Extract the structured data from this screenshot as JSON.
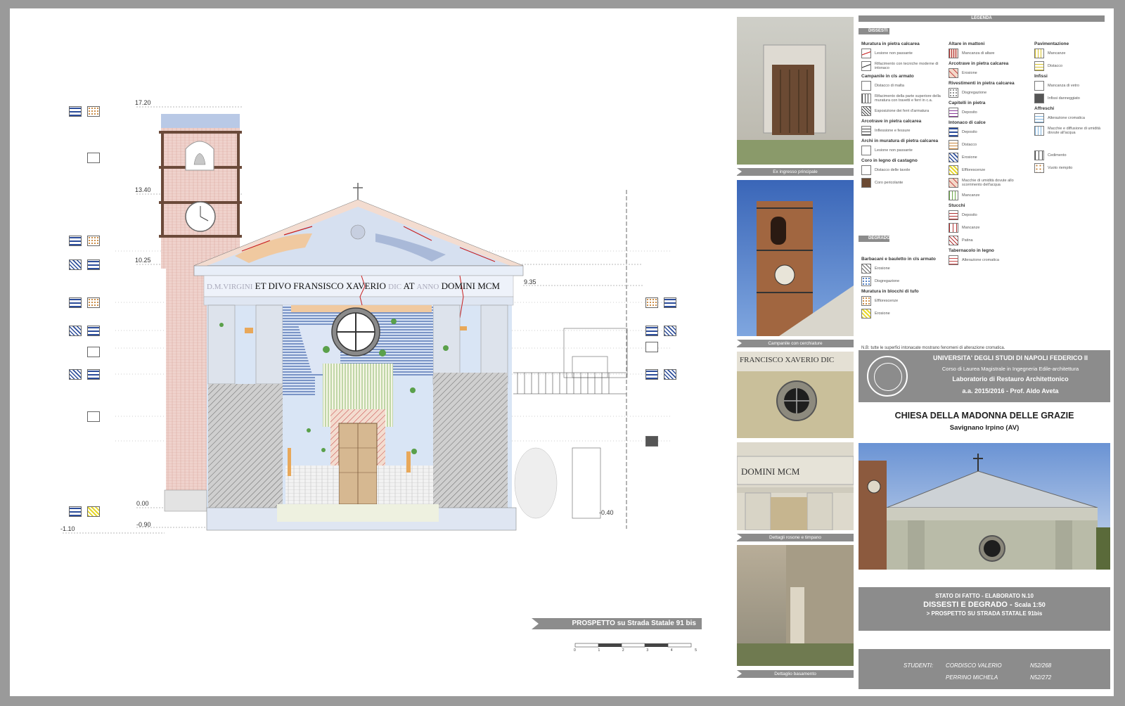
{
  "levels": {
    "l1720": "17.20",
    "l1340": "13.40",
    "l1025": "10.25",
    "l935": "9.35",
    "l000": "0.00",
    "lm090": "-0.90",
    "lm110": "-1.10",
    "lm040": "-0.40"
  },
  "inscription": {
    "part1": "D.M.VIRGINI",
    "part2": "ET DIVO FRANSISCO XAVERIO",
    "part3": "DIC",
    "part4": "AT",
    "part5": "ANNO",
    "part6": "DOMINI",
    "part7": "MCM"
  },
  "view_label": "PROSPETTO su Strada Statale 91 bis",
  "scale_bar": {
    "ticks": [
      "0",
      "1",
      "2",
      "3",
      "4",
      "5"
    ]
  },
  "photos": [
    {
      "caption": "Ex ingresso principale"
    },
    {
      "caption": "Campanile con cerchiature"
    },
    {
      "caption": "Dettaglio rosone",
      "inscription": "FRANCISCO XAVERIO DIC"
    },
    {
      "caption": "Dettagli rosone e timpano",
      "inscription": "DOMINI MCM"
    },
    {
      "caption": "Dettaglio basamento"
    }
  ],
  "legend": {
    "title": "LEGENDA",
    "dissesti_tag": "DISSESTI",
    "degrado_tag": "DEGRADO",
    "col1": [
      {
        "group": "Muratura in pietra calcarea",
        "items": [
          "Lesione non passante",
          "Rifacimento con tecniche moderne di intonaco"
        ]
      },
      {
        "group": "Campanile in cls armato",
        "items": [
          "Distacco di malta",
          "Rifacimento della parte superiore della muratura con travetti e ferri in c.a.",
          "Esposizione dei ferri d'armatura"
        ]
      },
      {
        "group": "Arcotrave in pietra calcarea",
        "items": [
          "Inflessione e fessure"
        ]
      },
      {
        "group": "Archi in muratura di pietra calcarea",
        "items": [
          "Lesione non passante"
        ]
      },
      {
        "group": "Coro in legno di castagno",
        "items": [
          "Distacco delle tavole",
          "Coro pericolante"
        ]
      }
    ],
    "col1_degrado": [
      {
        "group": "Barbacani e bauletto in cls armato",
        "items": [
          "Erosione",
          "Disgregazione"
        ]
      },
      {
        "group": "Muratura in blocchi di tufo",
        "items": [
          "Efflorescenze",
          "Erosione"
        ]
      }
    ],
    "col2": [
      {
        "group": "Altare in mattoni",
        "items": [
          "Mancanza di altare"
        ]
      },
      {
        "group": "Arcotrave in pietra calcarea",
        "items": [
          "Erosione"
        ]
      },
      {
        "group": "Rivestimenti in pietra calcarea",
        "items": [
          "Disgregazione"
        ]
      },
      {
        "group": "Capitelli in pietra",
        "items": [
          "Deposito"
        ]
      },
      {
        "group": "Intonaco di calce",
        "items": [
          "Deposito",
          "Distacco",
          "Erosione",
          "Efflorescenze",
          "Macchie di umidità dovute allo scorrimento dell'acqua",
          "Mancanze"
        ]
      },
      {
        "group": "Stucchi",
        "items": [
          "Deposito",
          "Mancanze",
          "Patina"
        ]
      },
      {
        "group": "Tabernacolo in legno",
        "items": [
          "Alterazione cromatica"
        ]
      }
    ],
    "col3": [
      {
        "group": "Pavimentazione",
        "items": [
          "Mancanze",
          "Distacco"
        ]
      },
      {
        "group": "Infissi",
        "items": [
          "Mancanza di vetro",
          "Infissi danneggiato"
        ]
      },
      {
        "group": "Affreschi",
        "items": [
          "Alterazione cromatica",
          "Macchie e diffusione di umidità dovute all'acqua"
        ]
      },
      {
        "group": "",
        "items": [
          "Cedimento",
          "Vuoto riempito"
        ]
      }
    ],
    "note": "N.B: tutte le superfici intonacate mostrano fenomeni di alterazione cromatica."
  },
  "university": {
    "name": "UNIVERSITA' DEGLI STUDI DI NAPOLI FEDERICO II",
    "course": "Corso di Laurea Magistrale in Ingegneria Edile-architettura",
    "lab": "Laboratorio di Restauro Architettonico",
    "year": "a.a. 2015/2016 - Prof. Aldo Aveta"
  },
  "church": {
    "title": "CHIESA DELLA MADONNA DELLE GRAZIE",
    "place": "Savignano Irpino (AV)"
  },
  "board": {
    "stato": "STATO DI FATTO - ELABORATO N.10",
    "title": "DISSESTI E DEGRADO -",
    "scale": "Scala 1:50",
    "sub": "> PROSPETTO SU STRADA STATALE 91bis"
  },
  "students": {
    "label": "STUDENTI:",
    "s1_name": "CORDISCO VALERIO",
    "s1_id": "N52/268",
    "s2_name": "PERRINO MICHELA",
    "s2_id": "N52/272"
  }
}
